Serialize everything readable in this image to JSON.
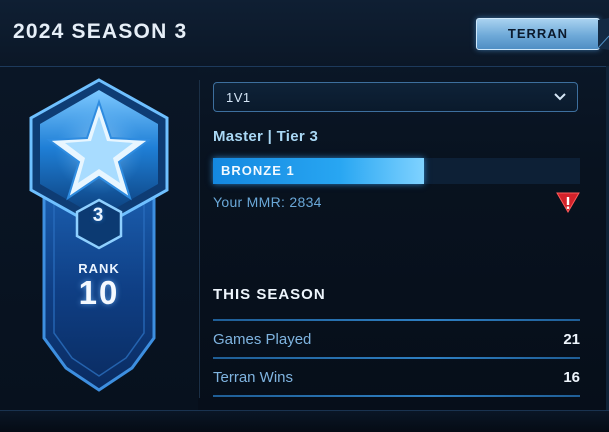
{
  "header": {
    "season_title": "2024 SEASON 3",
    "race_tab": "TERRAN"
  },
  "badge": {
    "tier_number": "3",
    "rank_label": "RANK",
    "rank_value": "10",
    "icon": "star-icon"
  },
  "mode_select": {
    "selected": "1V1",
    "icon": "chevron-down-icon"
  },
  "league": {
    "text": "Master | Tier 3",
    "division_label": "BRONZE 1",
    "progress_fraction": 0.575
  },
  "mmr": {
    "text": "Your MMR: 2834",
    "warning_icon": "warning-icon"
  },
  "season_stats": {
    "title": "THIS SEASON",
    "rows": [
      {
        "label": "Games Played",
        "value": "21"
      },
      {
        "label": "Terran Wins",
        "value": "16"
      }
    ]
  },
  "colors": {
    "accent": "#28a6f2",
    "warning": "#d3222a",
    "background": "#08121f"
  }
}
